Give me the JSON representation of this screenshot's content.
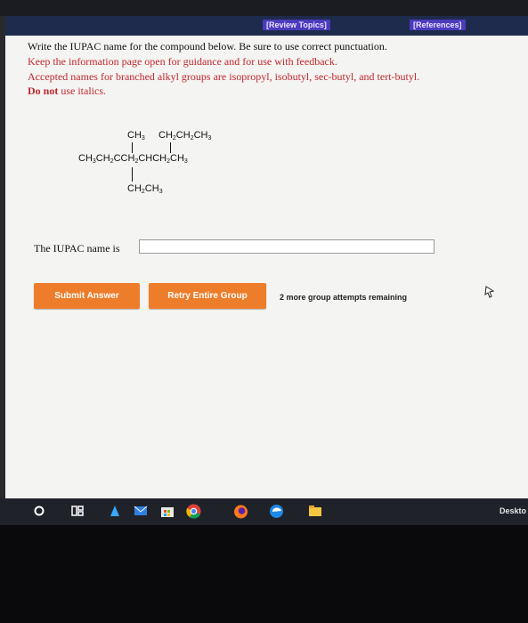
{
  "header": {
    "review_topics": "[Review Topics]",
    "references": "[References]"
  },
  "instructions": {
    "line1": "Write the IUPAC name for the compound below. Be sure to use correct punctuation.",
    "line2": "Keep the information page open for guidance and for use with feedback.",
    "line3": "Accepted names for branched alkyl groups are isopropyl, isobutyl, sec-butyl, and tert-butyl.",
    "line4_bold": "Do not",
    "line4_rest": " use italics."
  },
  "structure": {
    "top_left": "CH3",
    "top_right": "CH2CH2CH3",
    "main_chain": "CH3CH2CCH2CHCH2CH3",
    "bottom": "CH2CH3"
  },
  "answer": {
    "label": "The IUPAC name is",
    "value": "",
    "placeholder": ""
  },
  "actions": {
    "submit_label": "Submit Answer",
    "retry_label": "Retry Entire Group",
    "attempts_text": "2 more group attempts remaining"
  },
  "taskbar": {
    "desktop_label": "Deskto"
  },
  "colors": {
    "header_bg": "#1e2b4d",
    "link_bg": "#4b3bbd",
    "instruction_red": "#c0272d",
    "button_orange": "#ed7d2a"
  }
}
